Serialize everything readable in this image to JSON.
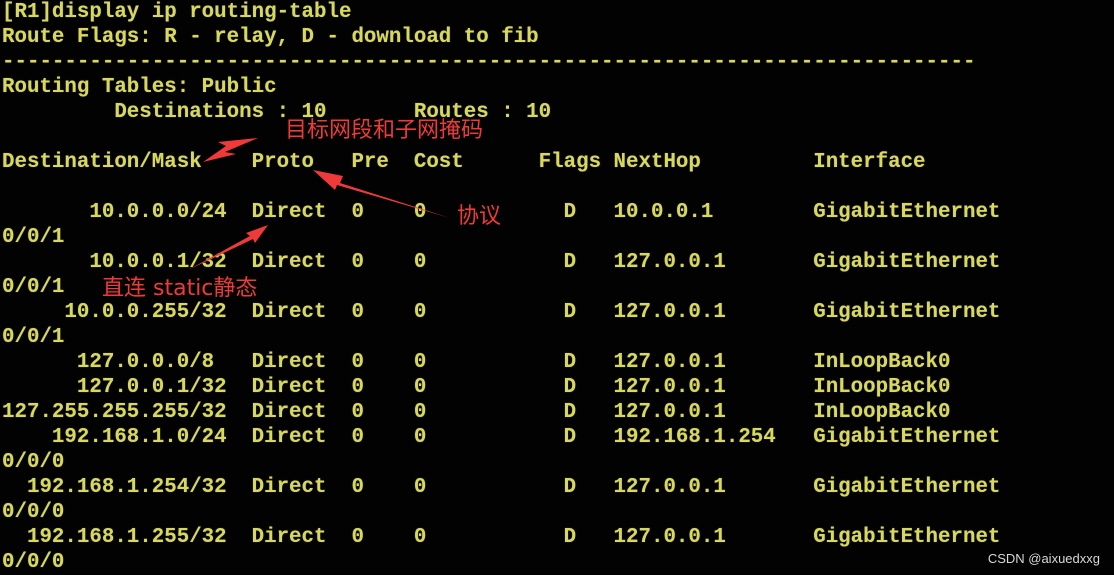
{
  "terminal": {
    "command": "[R1]display ip routing-table",
    "route_flags": "Route Flags: R - relay, D - download to fib",
    "separator": "------------------------------------------------------------------------------",
    "routing_tables": "Routing Tables: Public",
    "summary": "         Destinations : 10       Routes : 10",
    "header": "Destination/Mask    Proto   Pre  Cost      Flags NextHop         Interface",
    "columns": [
      "Destination/Mask",
      "Proto",
      "Pre",
      "Cost",
      "Flags",
      "NextHop",
      "Interface"
    ],
    "routes": [
      {
        "line": "       10.0.0.0/24  Direct  0    0           D   10.0.0.1        GigabitEthernet",
        "wrap": "0/0/1",
        "destination": "10.0.0.0/24",
        "proto": "Direct",
        "pre": "0",
        "cost": "0",
        "flags": "D",
        "nexthop": "10.0.0.1",
        "interface": "GigabitEthernet0/0/1"
      },
      {
        "line": "       10.0.0.1/32  Direct  0    0           D   127.0.0.1       GigabitEthernet",
        "wrap": "0/0/1",
        "destination": "10.0.0.1/32",
        "proto": "Direct",
        "pre": "0",
        "cost": "0",
        "flags": "D",
        "nexthop": "127.0.0.1",
        "interface": "GigabitEthernet0/0/1"
      },
      {
        "line": "     10.0.0.255/32  Direct  0    0           D   127.0.0.1       GigabitEthernet",
        "wrap": "0/0/1",
        "destination": "10.0.0.255/32",
        "proto": "Direct",
        "pre": "0",
        "cost": "0",
        "flags": "D",
        "nexthop": "127.0.0.1",
        "interface": "GigabitEthernet0/0/1"
      },
      {
        "line": "      127.0.0.0/8   Direct  0    0           D   127.0.0.1       InLoopBack0",
        "wrap": null,
        "destination": "127.0.0.0/8",
        "proto": "Direct",
        "pre": "0",
        "cost": "0",
        "flags": "D",
        "nexthop": "127.0.0.1",
        "interface": "InLoopBack0"
      },
      {
        "line": "      127.0.0.1/32  Direct  0    0           D   127.0.0.1       InLoopBack0",
        "wrap": null,
        "destination": "127.0.0.1/32",
        "proto": "Direct",
        "pre": "0",
        "cost": "0",
        "flags": "D",
        "nexthop": "127.0.0.1",
        "interface": "InLoopBack0"
      },
      {
        "line": "127.255.255.255/32  Direct  0    0           D   127.0.0.1       InLoopBack0",
        "wrap": null,
        "destination": "127.255.255.255/32",
        "proto": "Direct",
        "pre": "0",
        "cost": "0",
        "flags": "D",
        "nexthop": "127.0.0.1",
        "interface": "InLoopBack0"
      },
      {
        "line": "    192.168.1.0/24  Direct  0    0           D   192.168.1.254   GigabitEthernet",
        "wrap": "0/0/0",
        "destination": "192.168.1.0/24",
        "proto": "Direct",
        "pre": "0",
        "cost": "0",
        "flags": "D",
        "nexthop": "192.168.1.254",
        "interface": "GigabitEthernet0/0/0"
      },
      {
        "line": "  192.168.1.254/32  Direct  0    0           D   127.0.0.1       GigabitEthernet",
        "wrap": "0/0/0",
        "destination": "192.168.1.254/32",
        "proto": "Direct",
        "pre": "0",
        "cost": "0",
        "flags": "D",
        "nexthop": "127.0.0.1",
        "interface": "GigabitEthernet0/0/0"
      },
      {
        "line": "  192.168.1.255/32  Direct  0    0           D   127.0.0.1       GigabitEthernet",
        "wrap": "0/0/0",
        "destination": "192.168.1.255/32",
        "proto": "Direct",
        "pre": "0",
        "cost": "0",
        "flags": "D",
        "nexthop": "127.0.0.1",
        "interface": "GigabitEthernet0/0/0"
      }
    ]
  },
  "annotations": {
    "dest_mask": "目标网段和子网掩码",
    "proto": "协议",
    "direct": "直连  static静态"
  },
  "watermark": "CSDN @aixuedxxg",
  "colors": {
    "background": "#020202",
    "terminal_text": "#d8d860",
    "annotation": "#f03a3a"
  }
}
